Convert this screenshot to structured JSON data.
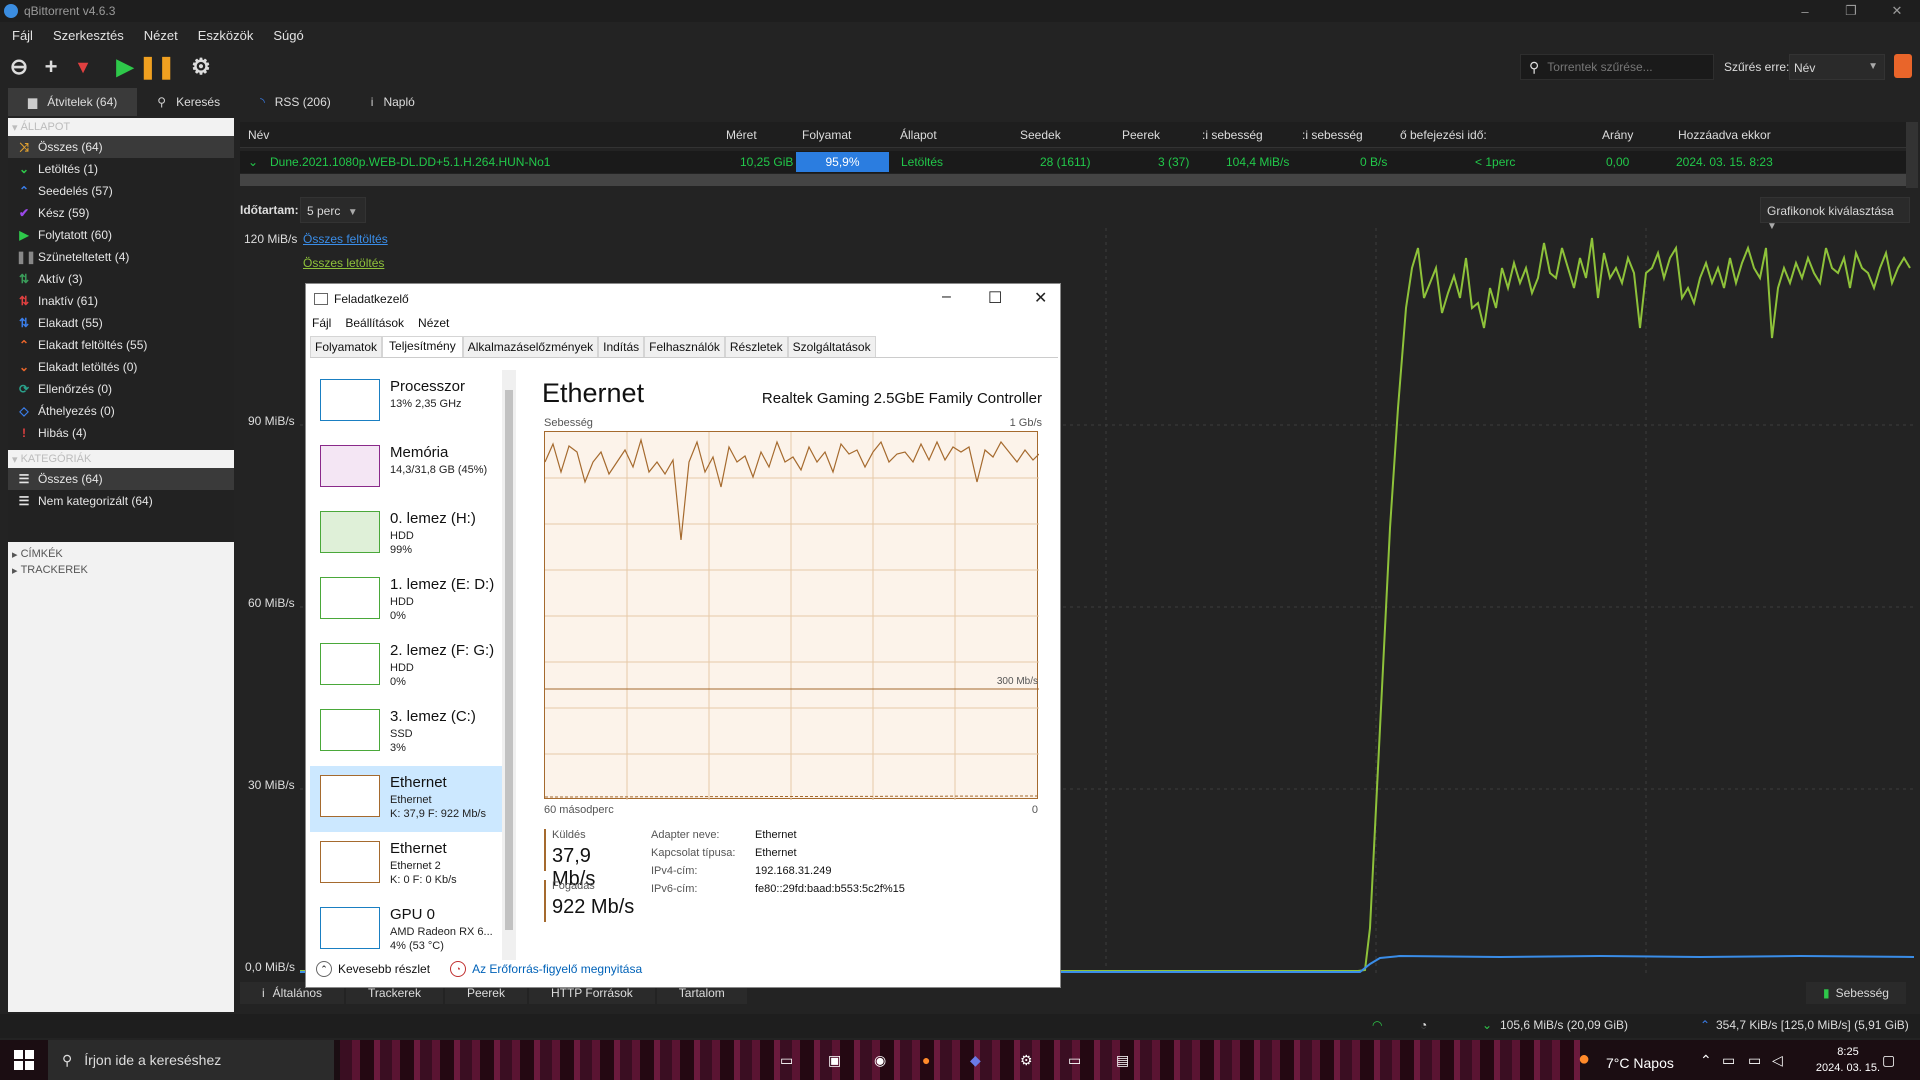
{
  "app": {
    "title": "qBittorrent v4.6.3"
  },
  "menu": [
    "Fájl",
    "Szerkesztés",
    "Nézet",
    "Eszközök",
    "Súgó"
  ],
  "toolbar": {
    "search_placeholder": "Torrentek szűrése...",
    "filter_label": "Szűrés erre:",
    "filter_value": "Név"
  },
  "tabs": [
    "Átvitelek (64)",
    "Keresés",
    "RSS (206)",
    "Napló"
  ],
  "sidebar": {
    "status_header": "ÁLLAPOT",
    "status": [
      {
        "label": "Összes (64)",
        "icon": "shuffle-icon",
        "color": "#e0a030"
      },
      {
        "label": "Letöltés (1)",
        "icon": "download-icon",
        "color": "#2ec84a"
      },
      {
        "label": "Seedelés (57)",
        "icon": "upload-icon",
        "color": "#3a7de8"
      },
      {
        "label": "Kész (59)",
        "icon": "check-icon",
        "color": "#9a48e8"
      },
      {
        "label": "Folytatott (60)",
        "icon": "play-icon",
        "color": "#2ec84a"
      },
      {
        "label": "Szüneteltetett (4)",
        "icon": "pause-icon",
        "color": "#888888"
      },
      {
        "label": "Aktív (3)",
        "icon": "active-arrows-icon",
        "color": "#3a9d5a"
      },
      {
        "label": "Inaktív (61)",
        "icon": "inactive-arrows-icon",
        "color": "#e04040"
      },
      {
        "label": "Elakadt (55)",
        "icon": "stalled-icon",
        "color": "#3a7de8"
      },
      {
        "label": "Elakadt feltöltés (55)",
        "icon": "stalled-upload-icon",
        "color": "#e8652a"
      },
      {
        "label": "Elakadt letöltés (0)",
        "icon": "stalled-download-icon",
        "color": "#e8652a"
      },
      {
        "label": "Ellenőrzés (0)",
        "icon": "refresh-icon",
        "color": "#2aa08a"
      },
      {
        "label": "Áthelyezés (0)",
        "icon": "move-icon",
        "color": "#3a7de8"
      },
      {
        "label": "Hibás (4)",
        "icon": "exclamation-icon",
        "color": "#e04040"
      }
    ],
    "categories_header": "KATEGÓRIÁK",
    "categories": [
      "Összes (64)",
      "Nem kategorizált (64)"
    ],
    "tags_header": "CÍMKÉK",
    "trackers_header": "TRACKEREK"
  },
  "table": {
    "headers": [
      "Név",
      "Méret",
      "Folyamat",
      "Állapot",
      "Seedek",
      "Peerek",
      ":i sebesség",
      ":i sebesség",
      "ő befejezési idő:",
      "Arány",
      "Hozzáadva ekkor"
    ],
    "row": {
      "name": "Dune.2021.1080p.WEB-DL.DD+5.1.H.264.HUN-No1",
      "size": "10,25 GiB",
      "progress": "95,9%",
      "progress_value": 0.959,
      "status": "Letöltés",
      "seeds": "28 (1611)",
      "peers": "3 (37)",
      "dl_speed": "104,4 MiB/s",
      "up_speed": "0 B/s",
      "eta": "< 1perc",
      "ratio": "0,00",
      "added": "2024. 03. 15. 8:23"
    }
  },
  "graph": {
    "duration_label": "Időtartam:",
    "duration_value": "5 perc",
    "select_label": "Grafikonok kiválasztása",
    "y_labels": [
      "120 MiB/s",
      "90 MiB/s",
      "60 MiB/s",
      "30 MiB/s",
      "0,0 MiB/s"
    ],
    "legend_upload": "Összes feltöltés",
    "legend_download": "Összes letöltés"
  },
  "bottom_tabs": [
    "Általános",
    "Trackerek",
    "Peerek",
    "HTTP Források",
    "Tartalom"
  ],
  "bottom_speed": "Sebesség",
  "status": {
    "dl": "105,6 MiB/s (20,09 GiB)",
    "ul": "354,7 KiB/s [125,0 MiB/s] (5,91 GiB)"
  },
  "taskbar": {
    "search": "Írjon ide a kereséshez",
    "weather": "7°C  Napos",
    "time": "8:25",
    "date": "2024. 03. 15."
  },
  "taskmanager": {
    "title": "Feladatkezelő",
    "menu": [
      "Fájl",
      "Beállítások",
      "Nézet"
    ],
    "tabs": [
      "Folyamatok",
      "Teljesítmény",
      "Alkalmazáselőzmények",
      "Indítás",
      "Felhasználók",
      "Részletek",
      "Szolgáltatások"
    ],
    "items": [
      {
        "name": "Processzor",
        "l1": "13% 2,35 GHz",
        "l2": "",
        "color": "#1a7fc2"
      },
      {
        "name": "Memória",
        "l1": "14,3/31,8 GB (45%)",
        "l2": "",
        "color": "#8a2a8a"
      },
      {
        "name": "0. lemez (H:)",
        "l1": "HDD",
        "l2": "99%",
        "color": "#4aa83a"
      },
      {
        "name": "1. lemez (E: D:)",
        "l1": "HDD",
        "l2": "0%",
        "color": "#4aa83a"
      },
      {
        "name": "2. lemez (F: G:)",
        "l1": "HDD",
        "l2": "0%",
        "color": "#4aa83a"
      },
      {
        "name": "3. lemez (C:)",
        "l1": "SSD",
        "l2": "3%",
        "color": "#4aa83a"
      },
      {
        "name": "Ethernet",
        "l1": "Ethernet",
        "l2": "K: 37,9  F: 922 Mb/s",
        "color": "#a56a2e"
      },
      {
        "name": "Ethernet",
        "l1": "Ethernet 2",
        "l2": "K: 0  F: 0 Kb/s",
        "color": "#a56a2e"
      },
      {
        "name": "GPU 0",
        "l1": "AMD Radeon RX 6...",
        "l2": "4% (53 °C)",
        "color": "#1a7fc2"
      }
    ],
    "heading": "Ethernet",
    "adapter": "Realtek Gaming 2.5GbE Family Controller",
    "speed_label": "Sebesség",
    "max_label": "1 Gb/s",
    "mid_label": "300 Mb/s",
    "x_left": "60 másodperc",
    "x_right": "0",
    "send_label": "Küldés",
    "send_value": "37,9 Mb/s",
    "recv_label": "Fogadás",
    "recv_value": "922 Mb/s",
    "props": [
      [
        "Adapter neve:",
        "Ethernet"
      ],
      [
        "Kapcsolat típusa:",
        "Ethernet"
      ],
      [
        "IPv4-cím:",
        "192.168.31.249"
      ],
      [
        "IPv6-cím:",
        "fe80::29fd:baad:b553:5c2f%15"
      ]
    ],
    "footer_less": "Kevesebb részlet",
    "footer_link": "Az Erőforrás-figyelő megnyitása"
  }
}
